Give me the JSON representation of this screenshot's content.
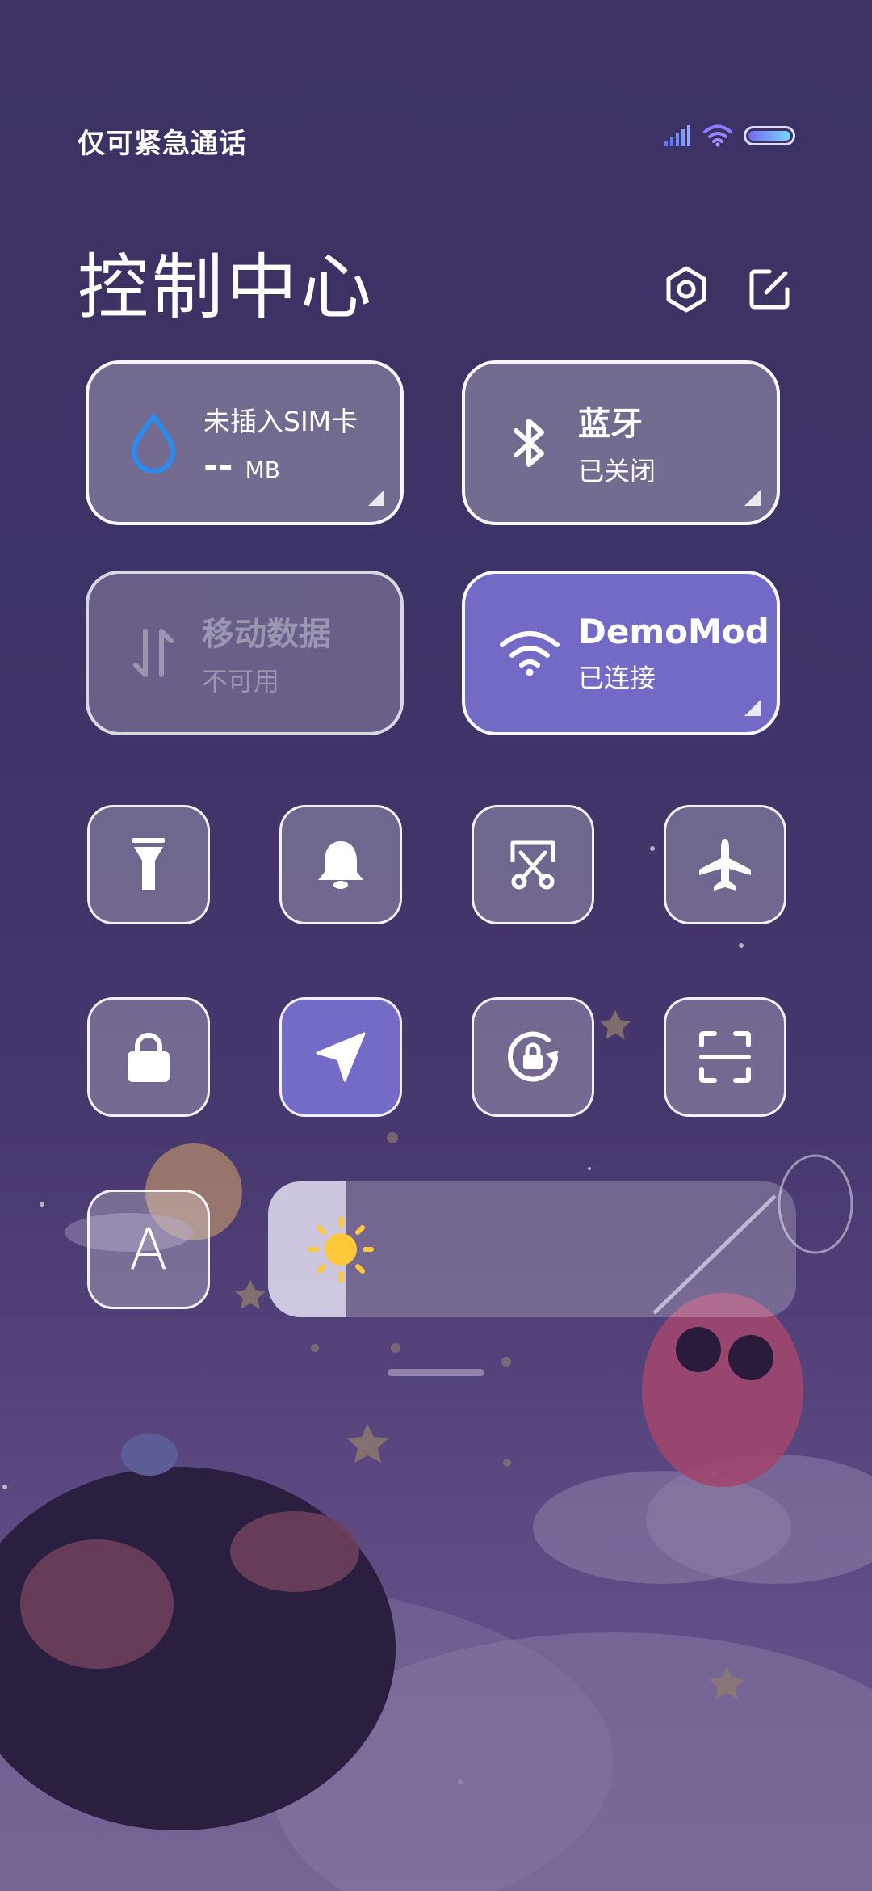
{
  "status": {
    "carrier_text": "仅可紧急通话",
    "battery_level": 1.0,
    "colors": {
      "signal": "#6f8cff",
      "wifi": "#9a7bff",
      "battery_fill": "#7ad7ff"
    }
  },
  "header": {
    "title": "控制中心",
    "icons": [
      "settings-icon",
      "edit-icon"
    ]
  },
  "tiles": [
    {
      "name": "mobile-data-usage",
      "icon": "water-drop-icon",
      "line1": "未插入SIM卡",
      "value": "--",
      "unit": "MB",
      "state": "normal"
    },
    {
      "name": "bluetooth",
      "icon": "bluetooth-icon",
      "line1": "蓝牙",
      "line2": "已关闭",
      "state": "normal"
    },
    {
      "name": "mobile-data",
      "icon": "data-transfer-icon",
      "line1": "移动数据",
      "line2": "不可用",
      "state": "disabled"
    },
    {
      "name": "wifi",
      "icon": "wifi-icon",
      "line1": "DemoMod",
      "line2": "已连接",
      "state": "active"
    }
  ],
  "toggles": [
    {
      "name": "flashlight",
      "icon": "flashlight-icon",
      "active": false
    },
    {
      "name": "ring",
      "icon": "bell-icon",
      "active": false
    },
    {
      "name": "screenshot",
      "icon": "scissors-screenshot-icon",
      "active": false
    },
    {
      "name": "airplane-mode",
      "icon": "airplane-icon",
      "active": false
    },
    {
      "name": "lock-screen",
      "icon": "lock-icon",
      "active": false
    },
    {
      "name": "location",
      "icon": "location-arrow-icon",
      "active": true
    },
    {
      "name": "rotation-lock",
      "icon": "rotation-lock-icon",
      "active": false
    },
    {
      "name": "scanner",
      "icon": "scan-icon",
      "active": false
    },
    {
      "name": "font-size",
      "icon": "letter-a-icon",
      "label": "A",
      "active": false
    }
  ],
  "brightness": {
    "level": 0.148,
    "icon": "sun-icon"
  },
  "colors": {
    "active": "#7b76d7",
    "sun": "#ffc83a",
    "drop": "#2a8cf0"
  }
}
